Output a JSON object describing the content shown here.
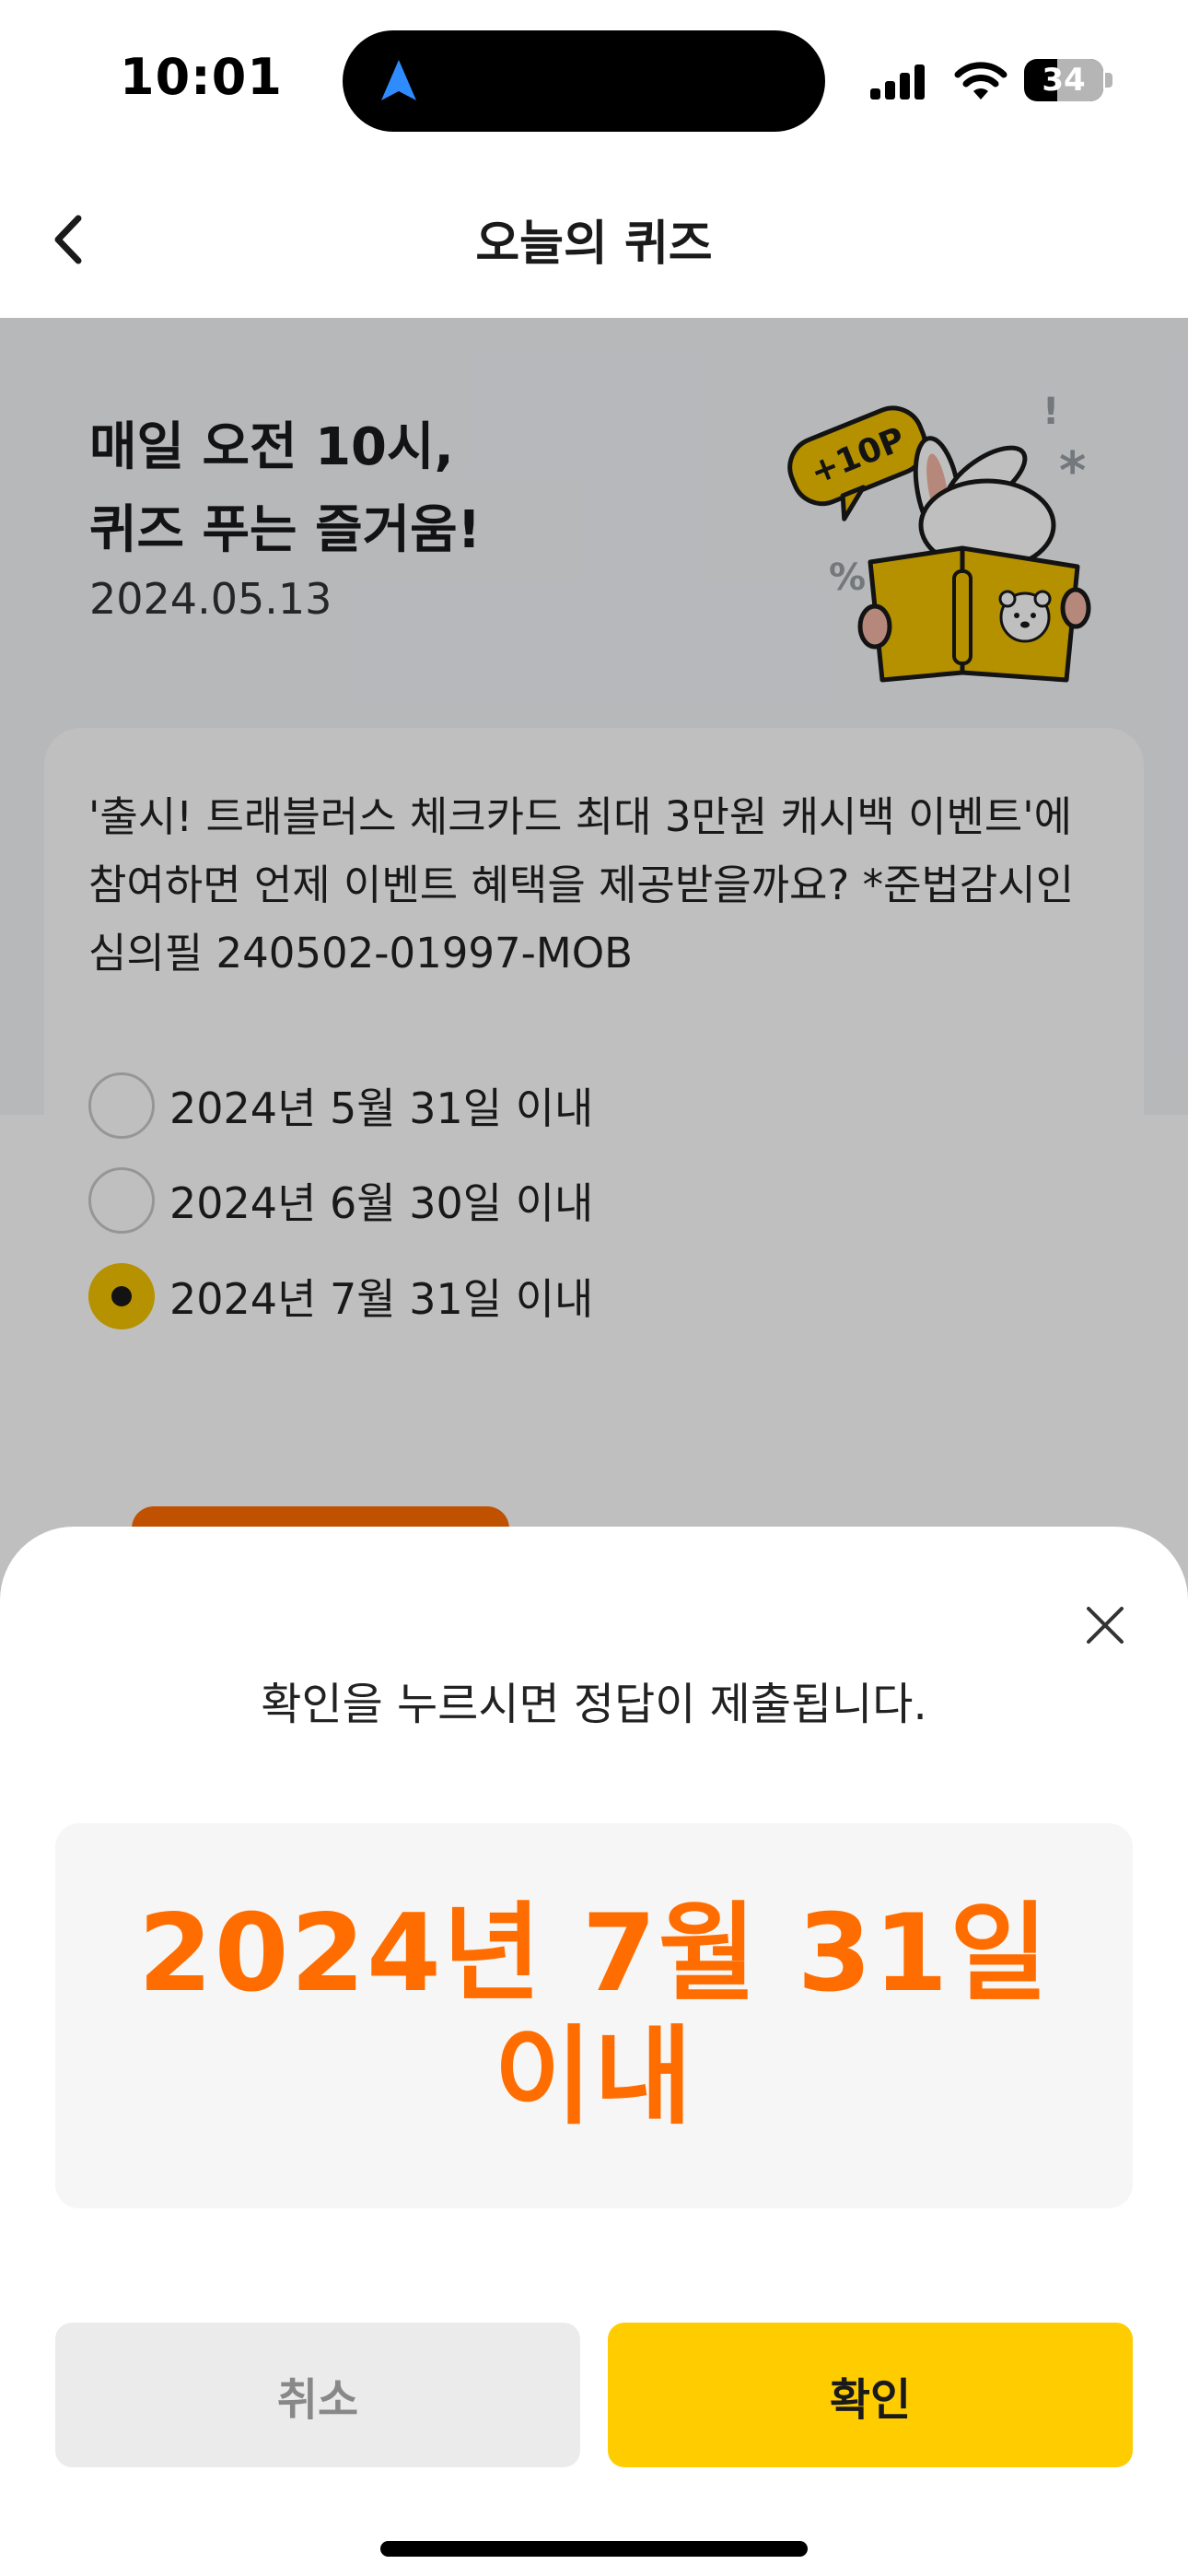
{
  "status_bar": {
    "time": "10:01",
    "battery": "34",
    "icons": [
      "location-arrow-icon",
      "signal-icon",
      "wifi-icon",
      "battery-icon"
    ]
  },
  "header": {
    "title": "오늘의 퀴즈",
    "back_icon": "chevron-left-icon"
  },
  "hero": {
    "line1": "매일 오전 10시,",
    "line2": "퀴즈 푸는 즐거움!",
    "date": "2024.05.13",
    "badge": "+10P"
  },
  "quiz": {
    "question": "'출시! 트래블러스 체크카드 최대 3만원 캐시백 이벤트'에 참여하면 언제 이벤트 혜택을 제공받을까요? *준법감시인 심의필 240502-01997-MOB",
    "options": [
      {
        "label": "2024년 5월 31일 이내",
        "selected": false
      },
      {
        "label": "2024년 6월 30일 이내",
        "selected": false
      },
      {
        "label": "2024년 7월 31일 이내",
        "selected": true
      }
    ]
  },
  "sheet": {
    "message": "확인을 누르시면 정답이 제출됩니다.",
    "answer": "2024년 7월 31일 이내",
    "cancel_label": "취소",
    "confirm_label": "확인",
    "close_icon": "close-icon"
  },
  "colors": {
    "accent_orange": "#ff6d00",
    "accent_yellow": "#ffcc00",
    "radio_selected": "#f3c200",
    "mascot_book": "#f2c200"
  }
}
